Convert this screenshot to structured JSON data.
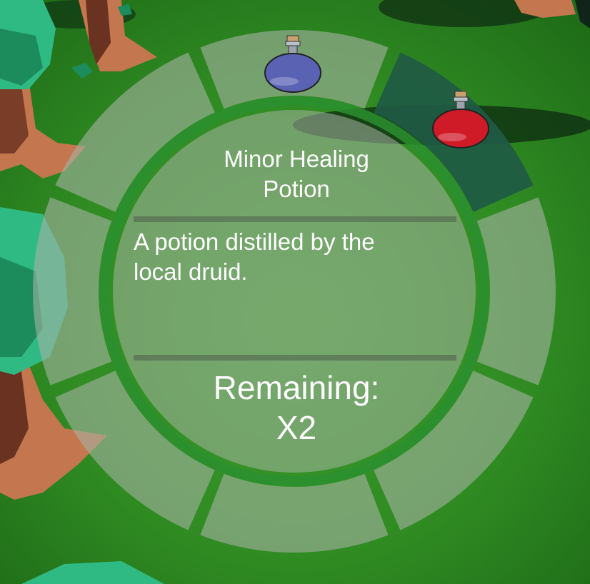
{
  "radial_menu": {
    "slot_count": 8,
    "selected_slot": 1,
    "slots": [
      {
        "item": "potion",
        "icon": "blue-potion-icon",
        "color": "#5a62b4"
      },
      {
        "item": "potion",
        "icon": "red-potion-icon",
        "color": "#cf1b27"
      },
      {
        "item": null
      },
      {
        "item": null
      },
      {
        "item": null
      },
      {
        "item": null
      },
      {
        "item": null
      },
      {
        "item": null
      }
    ]
  },
  "item_details": {
    "title_line1": "Minor Healing",
    "title_line2": "Potion",
    "description_line1": "A potion distilled by the",
    "description_line2": "local druid.",
    "remaining_label": "Remaining:",
    "remaining_count": "X2"
  },
  "colors": {
    "ring_green": "#2a8f2f",
    "selected_slot": "#1f5a44",
    "panel_gray": "#a7b3a3"
  }
}
